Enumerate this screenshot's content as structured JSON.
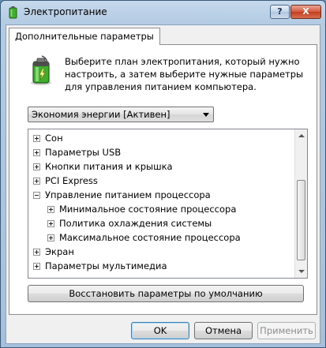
{
  "window": {
    "title": "Электропитание",
    "help_label": "?",
    "close_label": "X"
  },
  "tab": {
    "label": "Дополнительные параметры"
  },
  "description": "Выберите план электропитания, который нужно настроить, а затем выберите нужные параметры для управления питанием компьютера.",
  "plan_select": {
    "value": "Экономия энергии [Активен]"
  },
  "tree": {
    "items": [
      {
        "label": "Сон",
        "level": 0,
        "expanded": false
      },
      {
        "label": "Параметры USB",
        "level": 0,
        "expanded": false
      },
      {
        "label": "Кнопки питания и крышка",
        "level": 0,
        "expanded": false
      },
      {
        "label": "PCI Express",
        "level": 0,
        "expanded": false
      },
      {
        "label": "Управление питанием процессора",
        "level": 0,
        "expanded": true
      },
      {
        "label": "Минимальное состояние процессора",
        "level": 1,
        "expanded": false
      },
      {
        "label": "Политика охлаждения системы",
        "level": 1,
        "expanded": false
      },
      {
        "label": "Максимальное состояние процессора",
        "level": 1,
        "expanded": false
      },
      {
        "label": "Экран",
        "level": 0,
        "expanded": false
      },
      {
        "label": "Параметры мультимедиа",
        "level": 0,
        "expanded": false
      }
    ]
  },
  "restore_button": {
    "label": "Восстановить параметры по умолчанию"
  },
  "buttons": {
    "ok": "OK",
    "cancel": "Отмена",
    "apply": "Применить"
  },
  "icons": {
    "title": "battery-icon",
    "header": "battery-charge-icon"
  },
  "colors": {
    "titlebar": "#b3cbe3",
    "close_button": "#c43b1e",
    "battery_green": "#3fae2c"
  }
}
